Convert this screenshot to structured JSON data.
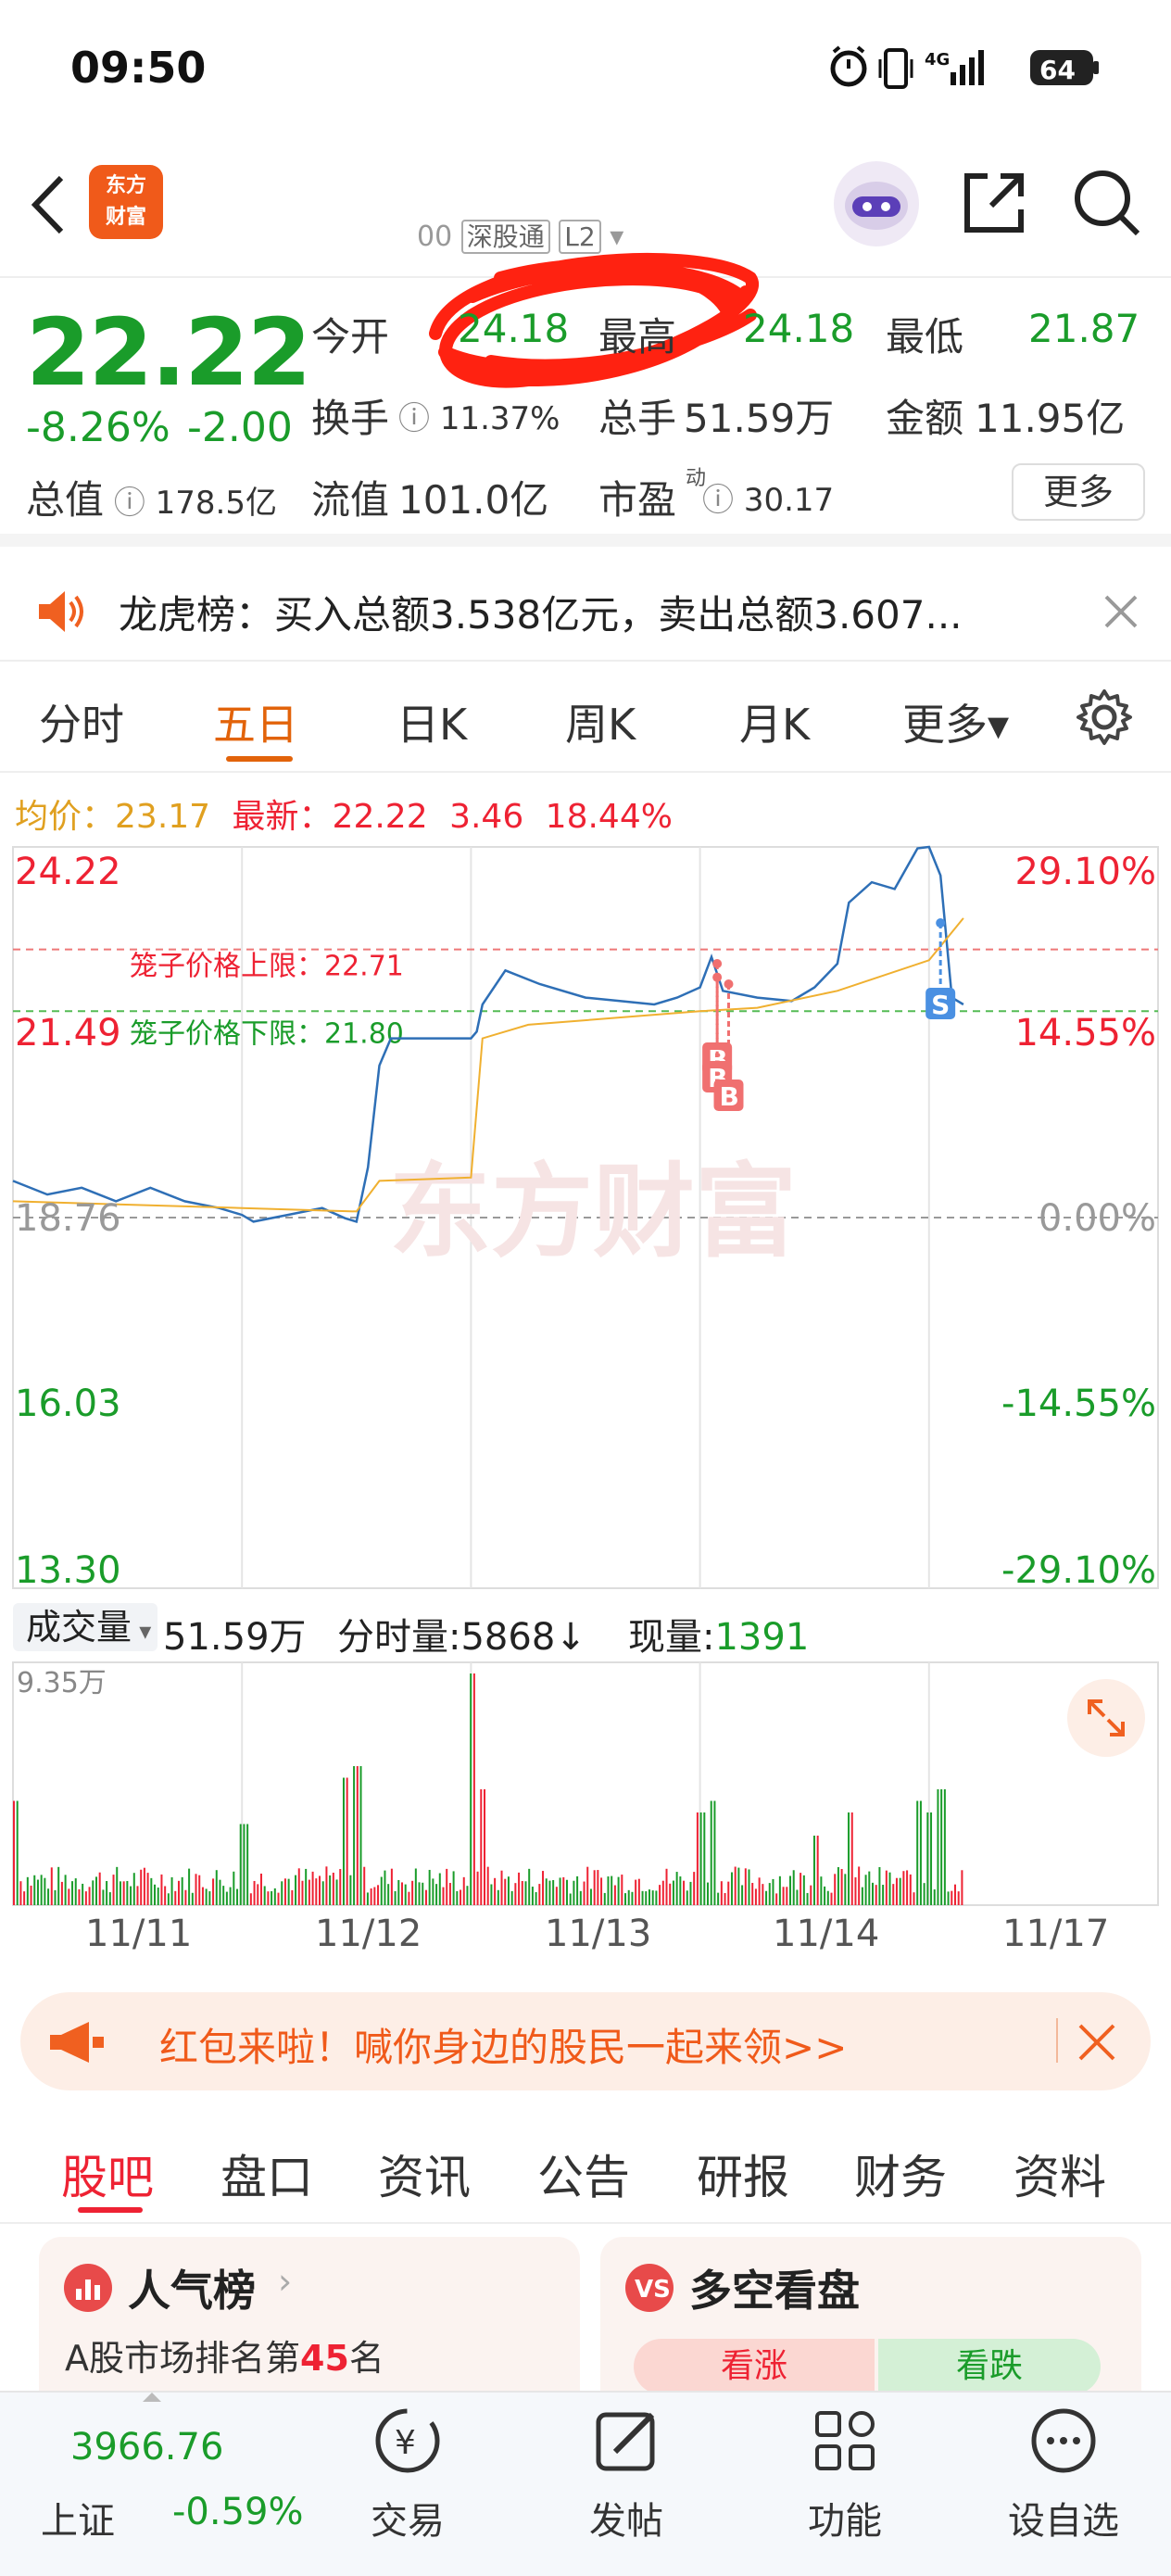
{
  "status_bar": {
    "time": "09:50",
    "battery": "64",
    "network": "4G"
  },
  "header": {
    "logo_text_1": "东方",
    "logo_text_2": "财富",
    "stock_code": "00 ",
    "market_badge": "深股通",
    "level_badge": "L2"
  },
  "quote": {
    "price": "22.22",
    "change_pct": "-8.26%",
    "change_amt": "-2.00",
    "open_label": "今开",
    "open": "24.18",
    "high_label": "最高",
    "high": "24.18",
    "low_label": "最低",
    "low": "21.87",
    "turnover_label": "换手",
    "turnover": "11.37%",
    "volume_label": "总手",
    "volume": "51.59万",
    "amount_label": "金额",
    "amount": "11.95亿",
    "mktcap_label": "总值",
    "mktcap": "178.5亿",
    "float_label": "流值",
    "float": "101.0亿",
    "pe_label": "市盈",
    "pe_sup": "动",
    "pe": "30.17",
    "more": "更多"
  },
  "notice": {
    "text": "龙虎榜：买入总额3.538亿元，卖出总额3.607..."
  },
  "tabs": [
    {
      "label": "分时"
    },
    {
      "label": "五日"
    },
    {
      "label": "日K"
    },
    {
      "label": "周K"
    },
    {
      "label": "月K"
    },
    {
      "label": "更多▾"
    }
  ],
  "avg_line": {
    "avg_label": "均价：",
    "avg": "23.17",
    "latest_label": "最新：",
    "latest": "22.22",
    "latest_chg": "3.46",
    "latest_pct": "18.44%"
  },
  "chart_data": {
    "type": "line",
    "x": [
      "11/11",
      "11/12",
      "11/13",
      "11/14",
      "11/17"
    ],
    "y_ticks_left": [
      "24.22",
      "21.49",
      "18.76",
      "16.03",
      "13.30"
    ],
    "y_ticks_right": [
      "29.10%",
      "14.55%",
      "0.00%",
      "-14.55%",
      "-29.10%"
    ],
    "ylim": [
      13.3,
      24.22
    ],
    "upper_limit_label": "笼子价格上限：",
    "upper_limit": "22.71",
    "lower_limit_label": "笼子价格下限：",
    "lower_limit": "21.80",
    "watermark": "东方财富",
    "series": [
      {
        "name": "price",
        "values": [
          [
            0,
            19.3
          ],
          [
            0.03,
            19.1
          ],
          [
            0.06,
            19.2
          ],
          [
            0.09,
            19.0
          ],
          [
            0.12,
            19.2
          ],
          [
            0.15,
            19.0
          ],
          [
            0.18,
            18.9
          ],
          [
            0.2,
            18.8
          ],
          [
            0.21,
            18.7
          ],
          [
            0.24,
            18.8
          ],
          [
            0.27,
            18.9
          ],
          [
            0.29,
            18.75
          ],
          [
            0.3,
            18.7
          ],
          [
            0.31,
            19.5
          ],
          [
            0.32,
            21.0
          ],
          [
            0.33,
            21.4
          ],
          [
            0.36,
            21.4
          ],
          [
            0.4,
            21.4
          ],
          [
            0.405,
            21.5
          ],
          [
            0.41,
            21.9
          ],
          [
            0.43,
            22.4
          ],
          [
            0.46,
            22.2
          ],
          [
            0.5,
            22.0
          ],
          [
            0.53,
            21.95
          ],
          [
            0.56,
            21.9
          ],
          [
            0.58,
            22.0
          ],
          [
            0.6,
            22.15
          ],
          [
            0.61,
            22.6
          ],
          [
            0.62,
            22.1
          ],
          [
            0.65,
            22.0
          ],
          [
            0.68,
            21.95
          ],
          [
            0.7,
            22.15
          ],
          [
            0.72,
            22.5
          ],
          [
            0.73,
            23.4
          ],
          [
            0.75,
            23.7
          ],
          [
            0.77,
            23.6
          ],
          [
            0.79,
            24.2
          ],
          [
            0.8,
            24.22
          ],
          [
            0.81,
            23.8
          ],
          [
            0.82,
            22.0
          ],
          [
            0.83,
            21.9
          ]
        ]
      },
      {
        "name": "avg",
        "values": [
          [
            0,
            19.0
          ],
          [
            0.2,
            18.9
          ],
          [
            0.3,
            18.85
          ],
          [
            0.32,
            19.3
          ],
          [
            0.4,
            19.35
          ],
          [
            0.41,
            21.4
          ],
          [
            0.45,
            21.6
          ],
          [
            0.6,
            21.8
          ],
          [
            0.65,
            21.85
          ],
          [
            0.72,
            22.1
          ],
          [
            0.8,
            22.55
          ],
          [
            0.83,
            23.17
          ]
        ]
      }
    ],
    "markers": [
      {
        "label": "B",
        "x": 0.615,
        "y": 22.5
      },
      {
        "label": "B",
        "x": 0.615,
        "y": 22.3
      },
      {
        "label": "B",
        "x": 0.625,
        "y": 22.2
      },
      {
        "label": "S",
        "x": 0.81,
        "y": 23.1
      }
    ]
  },
  "volume": {
    "selector": "成交量",
    "total": "51.59万",
    "tick_label": "分时量:",
    "tick": "5868↓",
    "now_label": "现量:",
    "now": "1391",
    "max": "9.35万"
  },
  "dates": [
    "11/11",
    "11/12",
    "11/13",
    "11/14",
    "11/17"
  ],
  "banner": {
    "text": "红包来啦！喊你身边的股民一起来领>>"
  },
  "subtabs": [
    {
      "label": "股吧"
    },
    {
      "label": "盘口"
    },
    {
      "label": "资讯"
    },
    {
      "label": "公告"
    },
    {
      "label": "研报"
    },
    {
      "label": "财务"
    },
    {
      "label": "资料"
    }
  ],
  "cards": {
    "left_title": "人气榜",
    "left_sub_prefix": "A股市场排名第",
    "left_rank": "45",
    "left_sub_suffix": "名",
    "right_title": "多空看盘",
    "bull": "看涨",
    "bear": "看跌"
  },
  "bottom_nav": {
    "index_value": "3966.76",
    "index_name": "上证",
    "index_chg": "-0.59%",
    "trade": "交易",
    "post": "发帖",
    "func": "功能",
    "watch": "设自选"
  }
}
